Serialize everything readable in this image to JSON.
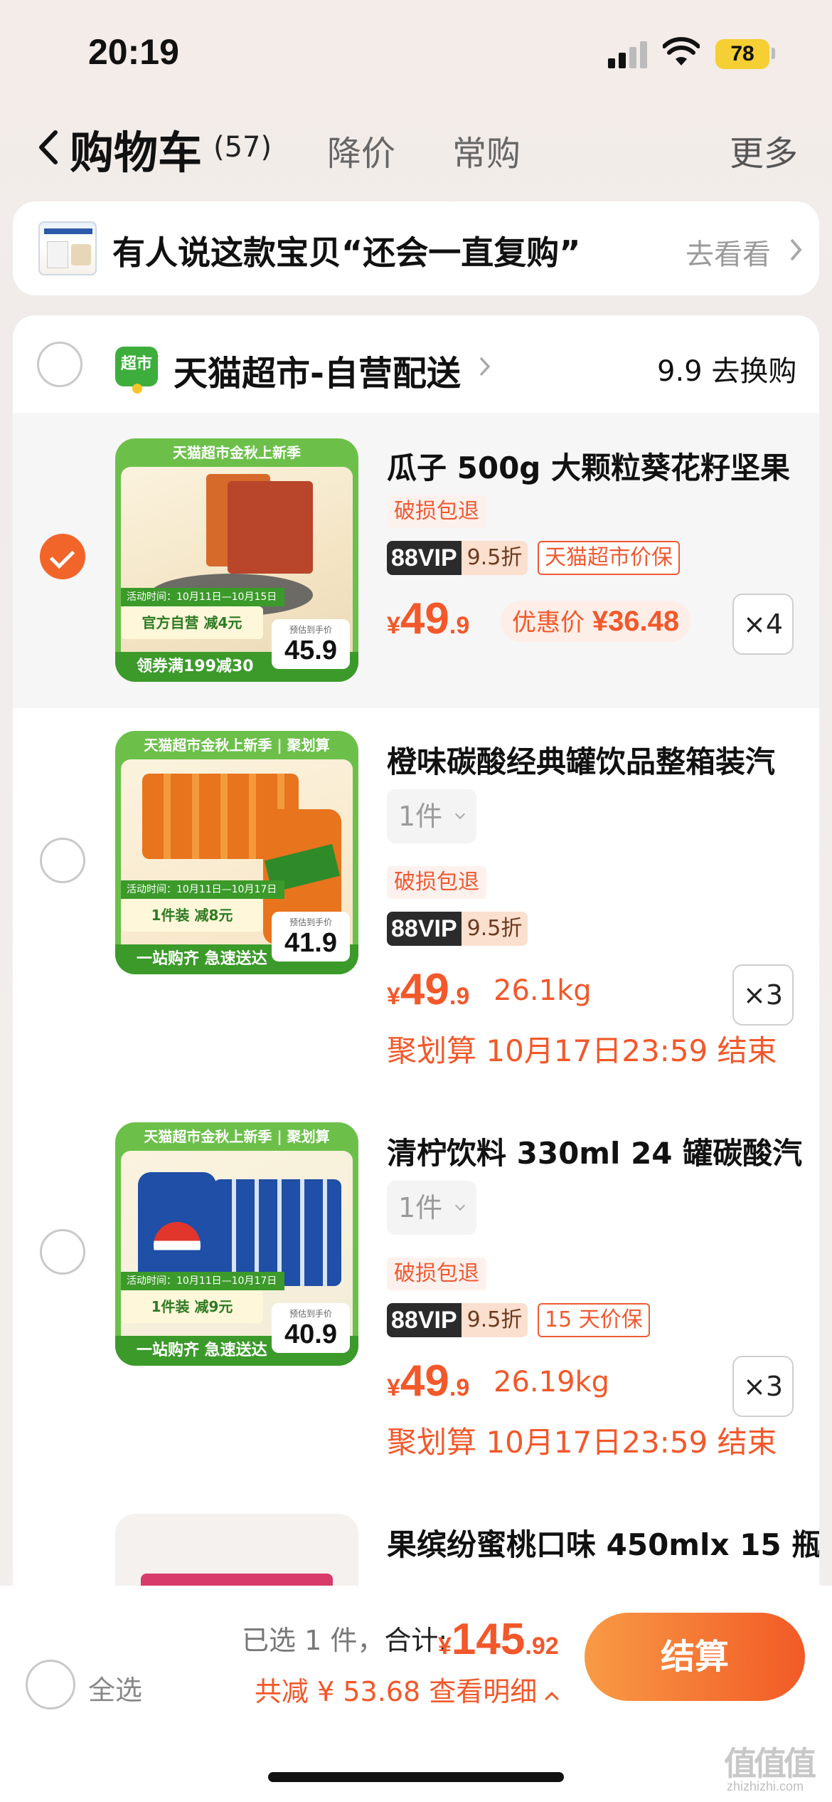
{
  "status_bar": {
    "time": "20:19",
    "battery": "78"
  },
  "nav": {
    "title": "购物车",
    "count": "(57)",
    "tabs": [
      "降价",
      "常购"
    ],
    "more": "更多"
  },
  "banner": {
    "text": "有人说这款宝贝“还会一直复购”",
    "link": "去看看"
  },
  "store": {
    "logo_text": "超市",
    "name": "天猫超市-自营配送",
    "promo": "9.9 去换购"
  },
  "items": [
    {
      "title": "瓜子 500g 大颗粒葵花籽坚果",
      "tag": "破损包退",
      "vip": "88VIP",
      "vip_discount": "9.5折",
      "guarantee": "天猫超市价保",
      "price_cur": "¥",
      "price_int": "49",
      "price_dec": ".9",
      "promo_label": "优惠价",
      "promo_cur": "¥",
      "promo_value": "36.48",
      "qty": "×4",
      "selected": true,
      "art": {
        "top": "天猫超市金秋上新季",
        "date": "活动时间：10月11日—10月15日",
        "mid": "官方自营 减4元",
        "bottom": "领券满199减30",
        "est": "预估到手价",
        "est_price": "45.9"
      }
    },
    {
      "title": "橙味碳酸经典罐饮品整箱装汽",
      "sku": "1件",
      "tag": "破损包退",
      "vip": "88VIP",
      "vip_discount": "9.5折",
      "price_cur": "¥",
      "price_int": "49",
      "price_dec": ".9",
      "weight": "26.1kg",
      "ju": "聚划算 10月17日23:59 结束",
      "qty": "×3",
      "selected": false,
      "art": {
        "top": "天猫超市金秋上新季 | 聚划算",
        "date": "活动时间：10月11日—10月17日",
        "mid": "1件装 减8元",
        "bottom": "一站购齐 急速送达",
        "est": "预估到手价",
        "est_price": "41.9"
      }
    },
    {
      "title": "清柠饮料 330ml 24 罐碳酸汽",
      "sku": "1件",
      "tag": "破损包退",
      "vip": "88VIP",
      "vip_discount": "9.5折",
      "guarantee": "15 天价保",
      "price_cur": "¥",
      "price_int": "49",
      "price_dec": ".9",
      "weight": "26.19kg",
      "ju": "聚划算 10月17日23:59 结束",
      "qty": "×3",
      "selected": false,
      "art": {
        "top": "天猫超市金秋上新季 | 聚划算",
        "date": "活动时间：10月11日—10月17日",
        "mid": "1件装 减9元",
        "bottom": "一站购齐 急速送达",
        "est": "预估到手价",
        "est_price": "40.9"
      }
    },
    {
      "title": "果缤纷蜜桃口味 450mlx 15 瓶",
      "selected": false
    }
  ],
  "checkout": {
    "select_all": "全选",
    "selected_count": "已选 1 件，",
    "total_label": "合计:",
    "total_cur": "¥",
    "total_int": "145",
    "total_dec": ".92",
    "savings": "共减 ¥ 53.68  查看明细",
    "button": "结算"
  },
  "watermark": {
    "logo": "值值值",
    "url": "zhizhizhi.com"
  },
  "colors": {
    "accent": "#f2582a",
    "checkout_start": "#f89a45",
    "checkout_end": "#f25a26",
    "store_green": "#3dae3c"
  }
}
